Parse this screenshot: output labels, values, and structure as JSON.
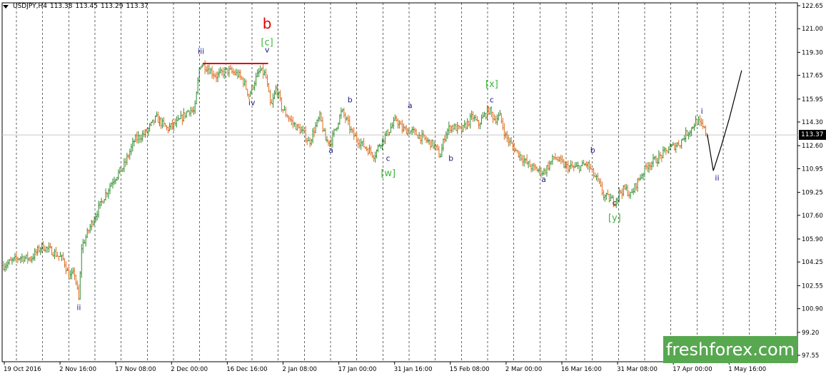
{
  "header": {
    "symbol": "USDJPY,H4",
    "open": "113.38",
    "high": "113.45",
    "low": "113.29",
    "close": "113.37"
  },
  "price_tag": "113.37",
  "watermark": "freshforex.com",
  "colors": {
    "bull_candle": "#2e8b2e",
    "bear_candle": "#e06a1a",
    "wave_label": "#1a1a8c",
    "bracket_label": "#3cb83c",
    "big_label": "#e00000",
    "resistance_line": "#e00000",
    "projection_line": "#000000",
    "watermark_bg": "#57a84f"
  },
  "chart_data": {
    "type": "candlestick",
    "y_ticks": [
      "122.65",
      "121.00",
      "119.30",
      "117.65",
      "115.95",
      "114.30",
      "112.60",
      "110.95",
      "109.25",
      "107.60",
      "105.90",
      "104.25",
      "102.55",
      "100.90",
      "99.20",
      "97.55"
    ],
    "ylim": [
      97.55,
      122.65
    ],
    "x_ticks": [
      "19 Oct 2016",
      "2 Nov 16:00",
      "17 Nov 08:00",
      "2 Dec 00:00",
      "16 Dec 16:00",
      "2 Jan 08:00",
      "17 Jan 00:00",
      "31 Jan 16:00",
      "15 Feb 08:00",
      "2 Mar 00:00",
      "16 Mar 16:00",
      "31 Mar 08:00",
      "17 Apr 00:00",
      "1 May 16:00"
    ],
    "price_path": [
      [
        0,
        104.0
      ],
      [
        3,
        104.6
      ],
      [
        5,
        104.5
      ],
      [
        7,
        105.4
      ],
      [
        9,
        105.0
      ],
      [
        11,
        104.4
      ],
      [
        12,
        103.2
      ],
      [
        13,
        103.4
      ],
      [
        13.8,
        101.5
      ],
      [
        14.3,
        105.3
      ],
      [
        16,
        106.9
      ],
      [
        18,
        108.6
      ],
      [
        20,
        110.1
      ],
      [
        22,
        111.1
      ],
      [
        24,
        113.0
      ],
      [
        26,
        113.5
      ],
      [
        28,
        114.6
      ],
      [
        30,
        113.8
      ],
      [
        32,
        114.3
      ],
      [
        34,
        115.2
      ],
      [
        35,
        115.0
      ],
      [
        36,
        118.5
      ],
      [
        37,
        118.3
      ],
      [
        39,
        117.6
      ],
      [
        41,
        118.0
      ],
      [
        43,
        117.7
      ],
      [
        44,
        117.2
      ],
      [
        45,
        116.2
      ],
      [
        46,
        117.2
      ],
      [
        47,
        118.0
      ],
      [
        48,
        117.7
      ],
      [
        49,
        115.3
      ],
      [
        50,
        116.8
      ],
      [
        51,
        115.3
      ],
      [
        53,
        114.2
      ],
      [
        55,
        113.5
      ],
      [
        56,
        112.8
      ],
      [
        57,
        113.8
      ],
      [
        58,
        114.7
      ],
      [
        59,
        113.0
      ],
      [
        60,
        112.9
      ],
      [
        62,
        115.1
      ],
      [
        63,
        114.3
      ],
      [
        64,
        113.4
      ],
      [
        66,
        112.6
      ],
      [
        68,
        111.9
      ],
      [
        69,
        112.8
      ],
      [
        70,
        113.3
      ],
      [
        72,
        114.5
      ],
      [
        73,
        113.8
      ],
      [
        75,
        113.6
      ],
      [
        77,
        113.1
      ],
      [
        79,
        112.6
      ],
      [
        80,
        111.8
      ],
      [
        81,
        113.5
      ],
      [
        82,
        114.0
      ],
      [
        84,
        113.7
      ],
      [
        86,
        114.7
      ],
      [
        87,
        114.1
      ],
      [
        88,
        114.7
      ],
      [
        89,
        115.2
      ],
      [
        90,
        114.5
      ],
      [
        91,
        114.7
      ],
      [
        92,
        113.3
      ],
      [
        93,
        112.7
      ],
      [
        94,
        112.2
      ],
      [
        96,
        111.3
      ],
      [
        97,
        111.0
      ],
      [
        99,
        110.7
      ],
      [
        101,
        111.8
      ],
      [
        103,
        111.1
      ],
      [
        105,
        111.0
      ],
      [
        107,
        111.3
      ],
      [
        108,
        110.6
      ],
      [
        109,
        110.0
      ],
      [
        110,
        109.0
      ],
      [
        111,
        108.8
      ],
      [
        112,
        108.6
      ],
      [
        113,
        109.3
      ],
      [
        114,
        109.5
      ],
      [
        115,
        109.0
      ],
      [
        116,
        109.9
      ],
      [
        118,
        111.2
      ],
      [
        120,
        111.7
      ],
      [
        122,
        112.4
      ],
      [
        124,
        112.8
      ],
      [
        125,
        113.4
      ],
      [
        126,
        113.8
      ],
      [
        127,
        114.4
      ],
      [
        128,
        114.0
      ],
      [
        129,
        113.4
      ]
    ],
    "projection": [
      [
        129,
        113.4
      ],
      [
        130.1,
        110.8
      ],
      [
        131.5,
        112.5
      ],
      [
        133,
        114.5
      ],
      [
        135.3,
        118.0
      ]
    ],
    "resistance": {
      "from": [
        36.5,
        118.5
      ],
      "to": [
        48.5,
        118.5
      ]
    },
    "wave_labels": [
      {
        "text": "ii",
        "x": 13.8,
        "y": 100.8,
        "style": "wave"
      },
      {
        "text": "iii",
        "x": 36.2,
        "y": 119.2,
        "style": "wave"
      },
      {
        "text": "iv",
        "x": 45.5,
        "y": 115.5,
        "style": "wave"
      },
      {
        "text": "v",
        "x": 48.3,
        "y": 119.3,
        "style": "wave"
      },
      {
        "text": "[c]",
        "x": 48.3,
        "y": 119.8,
        "style": "bracket"
      },
      {
        "text": "b",
        "x": 48.3,
        "y": 121.0,
        "style": "big"
      },
      {
        "text": "a",
        "x": 60.0,
        "y": 112.1,
        "style": "wave"
      },
      {
        "text": "b",
        "x": 63.5,
        "y": 115.7,
        "style": "wave"
      },
      {
        "text": "c",
        "x": 70.5,
        "y": 111.5,
        "style": "wave"
      },
      {
        "text": "[w]",
        "x": 70.5,
        "y": 110.4,
        "style": "bracket"
      },
      {
        "text": "a",
        "x": 74.5,
        "y": 115.3,
        "style": "wave"
      },
      {
        "text": "b",
        "x": 82.0,
        "y": 111.5,
        "style": "wave"
      },
      {
        "text": "c",
        "x": 89.5,
        "y": 115.7,
        "style": "wave"
      },
      {
        "text": "[x]",
        "x": 89.5,
        "y": 116.8,
        "style": "bracket"
      },
      {
        "text": "a",
        "x": 99.0,
        "y": 110.0,
        "style": "wave"
      },
      {
        "text": "b",
        "x": 108.0,
        "y": 112.1,
        "style": "wave"
      },
      {
        "text": "c",
        "x": 112.0,
        "y": 108.3,
        "style": "wave"
      },
      {
        "text": "[y]",
        "x": 112.0,
        "y": 107.2,
        "style": "bracket"
      },
      {
        "text": "i",
        "x": 128.0,
        "y": 114.9,
        "style": "wave"
      },
      {
        "text": "ii",
        "x": 130.8,
        "y": 110.1,
        "style": "wave"
      }
    ]
  }
}
